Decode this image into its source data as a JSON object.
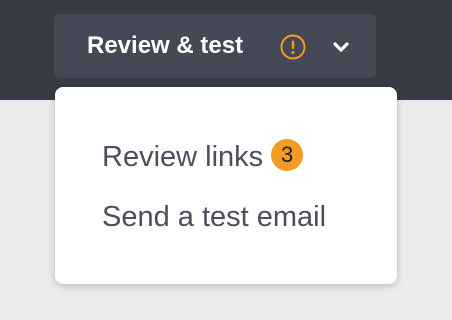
{
  "colors": {
    "topbar": "#373b45",
    "button": "#444955",
    "accent": "#f59a23",
    "menu_text": "#4b4f5c",
    "page_bg": "#ebebed"
  },
  "header": {
    "button_label": "Review & test",
    "warning_icon": "exclamation-circle-icon",
    "dropdown_icon": "chevron-down-icon"
  },
  "menu": {
    "items": [
      {
        "label": "Review links",
        "badge": "3"
      },
      {
        "label": "Send a test email"
      }
    ]
  }
}
